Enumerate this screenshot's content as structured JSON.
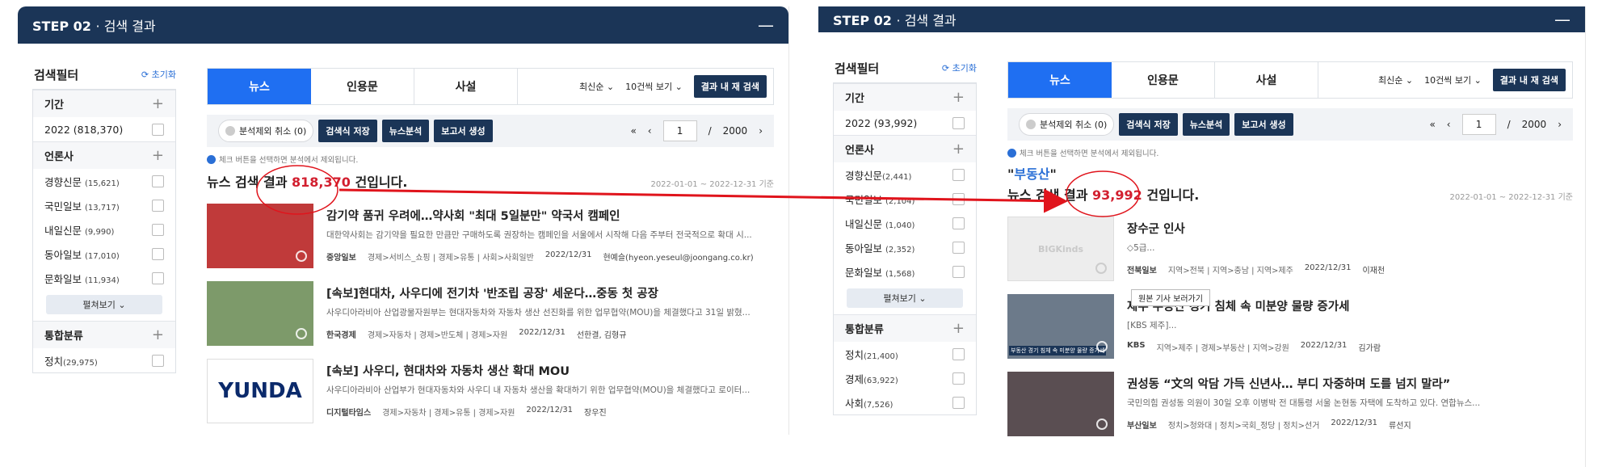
{
  "step": {
    "title": "STEP 02",
    "subtitle": "· 검색 결과",
    "minimize": "—"
  },
  "filter": {
    "title": "검색필터",
    "reset": "⟳ 초기화",
    "more_label": "펼쳐보기 ⌄"
  },
  "left": {
    "sections": [
      {
        "label": "기간",
        "rows": [
          {
            "label": "2022",
            "count": "(818,370)"
          }
        ]
      },
      {
        "label": "언론사",
        "rows": [
          {
            "label": "경향신문",
            "count": "(15,621)"
          },
          {
            "label": "국민일보",
            "count": "(13,717)"
          },
          {
            "label": "내일신문",
            "count": "(9,990)"
          },
          {
            "label": "동아일보",
            "count": "(17,010)"
          },
          {
            "label": "문화일보",
            "count": "(11,934)"
          }
        ]
      },
      {
        "label": "통합분류",
        "rows": [
          {
            "label": "정치",
            "count": "(29,975)"
          }
        ]
      }
    ],
    "summary_prefix": "뉴스 검색 결과 ",
    "summary_count": "818,370",
    "summary_suffix": " 건입니다.",
    "date_range": "2022-01-01 ~ 2022-12-31 기준",
    "items": [
      {
        "headline": "감기약 품귀 우려에…약사회 \"최대 5일분만\" 약국서 캠페인",
        "excerpt": "대한약사회는 감기약을 필요한 만큼만 구매하도록 권장하는 캠페인을 서울에서 시작해 다음 주부터 전국적으로 확대 시...",
        "source": "중앙일보",
        "category": "경제>서비스_쇼핑 | 경제>유통 | 사회>사회일반",
        "date": "2022/12/31",
        "author": "현예슬(hyeon.yeseul@joongang.co.kr)",
        "thumb_color": "#c03a3a"
      },
      {
        "headline": "[속보]현대차, 사우디에 전기차 '반조립 공장' 세운다…중동 첫 공장",
        "excerpt": "사우디아라비아 산업광물자원부는 현대자동차와 자동차 생산 선진화를 위한 업무협약(MOU)을 체결했다고 31일 밝혔...",
        "source": "한국경제",
        "category": "경제>자동차 | 경제>반도체 | 경제>자원",
        "date": "2022/12/31",
        "author": "선한결, 김형규",
        "thumb_color": "#7d9a6a"
      },
      {
        "headline": "[속보] 사우디, 현대차와 자동차 생산 확대 MOU",
        "excerpt": "사우디아라비아 산업부가 현대자동차와 사우디 내 자동차 생산을 확대하기 위한 업무협약(MOU)을 체결했다고 로이터...",
        "source": "디지털타임스",
        "category": "경제>자동차 | 경제>유통 | 경제>자원",
        "date": "2022/12/31",
        "author": "장우진",
        "thumb_color": "#ffffff",
        "thumb_text": "YUNDA"
      }
    ]
  },
  "right": {
    "sections": [
      {
        "label": "기간",
        "rows": [
          {
            "label": "2022",
            "count": "(93,992)"
          }
        ]
      },
      {
        "label": "언론사",
        "rows": [
          {
            "label": "경향신문",
            "count": "(2,441)"
          },
          {
            "label": "국민일보",
            "count": "(2,104)"
          },
          {
            "label": "내일신문",
            "count": "(1,040)"
          },
          {
            "label": "동아일보",
            "count": "(2,352)"
          },
          {
            "label": "문화일보",
            "count": "(1,568)"
          }
        ]
      },
      {
        "label": "통합분류",
        "rows": [
          {
            "label": "정치",
            "count": "(21,400)"
          },
          {
            "label": "경제",
            "count": "(63,922)"
          },
          {
            "label": "사회",
            "count": "(7,526)"
          }
        ]
      }
    ],
    "query_open": "\"",
    "query": "부동산",
    "query_close": "\"",
    "summary_prefix": "뉴스 검색 결과 ",
    "summary_count": "93,992",
    "summary_suffix": " 건입니다.",
    "date_range": "2022-01-01 ~ 2022-12-31 기준",
    "tooltip": "원본 기사 보러가기",
    "items": [
      {
        "headline": "장수군 인사",
        "excerpt": "◇5급...",
        "source": "전북일보",
        "category": "지역>전북 | 지역>충남 | 지역>제주",
        "date": "2022/12/31",
        "author": "이재천",
        "thumb_color": "#ededed",
        "thumb_text": "BIGKinds"
      },
      {
        "headline": "제주 부동산 경기 침체 속 미분양 물량 증가세",
        "excerpt": "[KBS 제주]...",
        "source": "KBS",
        "category": "지역>제주 | 경제>부동산 | 지역>강원",
        "date": "2022/12/31",
        "author": "김가람",
        "thumb_color": "#6c7a8a",
        "thumb_text": "부동산 경기 침체 속 미분양 물량 증가세"
      },
      {
        "headline": "권성동 “文의 악담 가득 신년사… 부디 자중하며 도를 넘지 말라”",
        "excerpt": "국민의힘 권성동 의원이 30일 오후 이병박 전 대통령 서울 논현동 자택에 도착하고 있다. 연합뉴스...",
        "source": "부산일보",
        "category": "정치>청와대 | 정치>국회_정당 | 정치>선거",
        "date": "2022/12/31",
        "author": "류선지",
        "thumb_color": "#5a4e52"
      }
    ]
  },
  "tabs": [
    "뉴스",
    "인용문",
    "사설"
  ],
  "sort": "최신순 ⌄",
  "page_size": "10건씩 보기 ⌄",
  "research_btn": "결과 내 재 검색",
  "toolbar": {
    "exclude": "분석제외 취소 (0)",
    "save": "검색식 저장",
    "analyze": "뉴스분석",
    "report": "보고서 생성"
  },
  "pager": {
    "first": "«",
    "prev": "‹",
    "current": "1",
    "sep": "/",
    "total": "2000",
    "next": "›"
  },
  "note": "체크 버튼을 선택하면 분석에서 제외됩니다.",
  "colors": {
    "accent": "#1f6ff2",
    "header": "#1b3557",
    "highlight": "#d21f2f",
    "annotation": "#e0141c"
  }
}
